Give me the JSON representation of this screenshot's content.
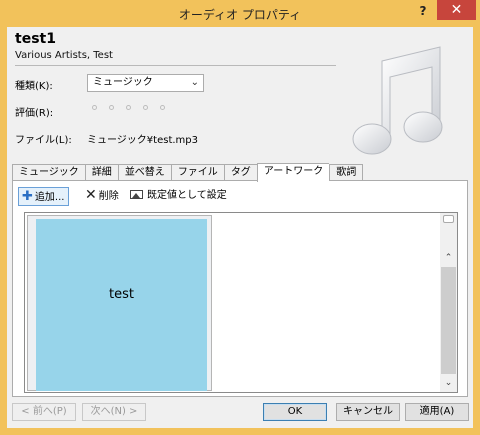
{
  "window": {
    "title": "オーディオ プロパティ",
    "help": "?",
    "close": "✕"
  },
  "header": {
    "name": "test1",
    "artist": "Various Artists, Test",
    "type_label": "種類(K):",
    "type_value": "ミュージック",
    "rating_label": "評価(R):",
    "rating_value": 0,
    "file_label": "ファイル(L):",
    "file_value": "ミュージック¥test.mp3"
  },
  "tabs": [
    {
      "label": "ミュージック"
    },
    {
      "label": "詳細"
    },
    {
      "label": "並べ替え"
    },
    {
      "label": "ファイル"
    },
    {
      "label": "タグ"
    },
    {
      "label": "アートワーク"
    },
    {
      "label": "歌詞"
    }
  ],
  "artwork": {
    "add_label": "追加...",
    "delete_label": "削除",
    "set_default_label": "既定値として設定",
    "items": [
      {
        "label": "test"
      }
    ]
  },
  "footer": {
    "prev_label": "< 前へ(P)",
    "next_label": "次へ(N) >",
    "ok_label": "OK",
    "cancel_label": "キャンセル",
    "apply_label": "適用(A)"
  },
  "colors": {
    "frame": "#f2c25b",
    "close": "#c7453c",
    "artwork_tile": "#97d4ea"
  },
  "icons": {
    "add": "plus-icon",
    "delete": "x-icon",
    "set_default": "image-icon",
    "cover": "music-note-icon"
  }
}
